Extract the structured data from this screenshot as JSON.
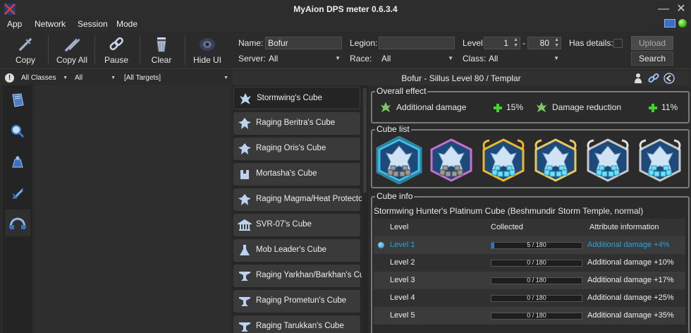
{
  "window": {
    "title": "MyAion DPS meter 0.6.3.4"
  },
  "menu": [
    "App",
    "Network",
    "Session",
    "Mode"
  ],
  "toolbar": {
    "buttons": [
      {
        "label": "Copy",
        "icon": "copy-icon"
      },
      {
        "label": "Copy All",
        "icon": "copy-all-icon"
      },
      {
        "label": "Pause",
        "icon": "chain-icon"
      },
      {
        "label": "Clear",
        "icon": "trash-icon"
      },
      {
        "label": "Hide UI",
        "icon": "eye-icon"
      }
    ]
  },
  "search_form": {
    "name_label": "Name:",
    "name_value": "Bofur",
    "legion_label": "Legion:",
    "legion_value": "",
    "level_label": "Level:",
    "level_min": "1",
    "level_sep": "-",
    "level_max": "80",
    "has_details_label": "Has details:",
    "server_label": "Server:",
    "server_value": "All",
    "race_label": "Race:",
    "race_value": "All",
    "class_label": "Class:",
    "class_value": "All",
    "upload_label": "Upload",
    "search_label": "Search"
  },
  "filters": {
    "classes": "All Classes",
    "type": "All",
    "targets": "[All Targets]"
  },
  "character_header": "Bofur - Sillus   Level 80 / Templar",
  "cube_names": [
    "Stormwing's Cube",
    "Raging Beritra's Cube",
    "Raging Oris's Cube",
    "Mortasha's Cube",
    "Raging Magma/Heat Protector",
    "SVR-07's Cube",
    "Mob Leader's Cube",
    "Raging Yarkhan/Barkhan's Cube",
    "Raging Prometun's Cube",
    "Raging Tarukkan's Cube"
  ],
  "overall_effect": {
    "title": "Overall effect",
    "items": [
      {
        "name": "Additional damage",
        "value": "15%"
      },
      {
        "name": "Damage reduction",
        "value": "11%"
      }
    ]
  },
  "cube_list": {
    "title": "Cube list",
    "frames": [
      "#39c3f0",
      "#c86fd0",
      "#e8b930",
      "#e8c860",
      "#c8c8c8",
      "#c8c8c8"
    ]
  },
  "cube_info": {
    "title": "Cube info",
    "subtitle": "Stormwing Hunter's Platinum Cube (Beshmundir Storm Temple, normal)",
    "columns": [
      "Level",
      "Collected",
      "Attribute information"
    ],
    "rows": [
      {
        "level": "Level 1",
        "collected": "5 / 180",
        "fraction": 0.028,
        "attribute": "Additional damage +4%",
        "active": true
      },
      {
        "level": "Level 2",
        "collected": "0 / 180",
        "fraction": 0,
        "attribute": "Additional damage +10%",
        "active": false
      },
      {
        "level": "Level 3",
        "collected": "0 / 180",
        "fraction": 0,
        "attribute": "Additional damage +17%",
        "active": false
      },
      {
        "level": "Level 4",
        "collected": "0 / 180",
        "fraction": 0,
        "attribute": "Additional damage +25%",
        "active": false
      },
      {
        "level": "Level 5",
        "collected": "0 / 180",
        "fraction": 0,
        "attribute": "Additional damage +35%",
        "active": false
      }
    ]
  }
}
